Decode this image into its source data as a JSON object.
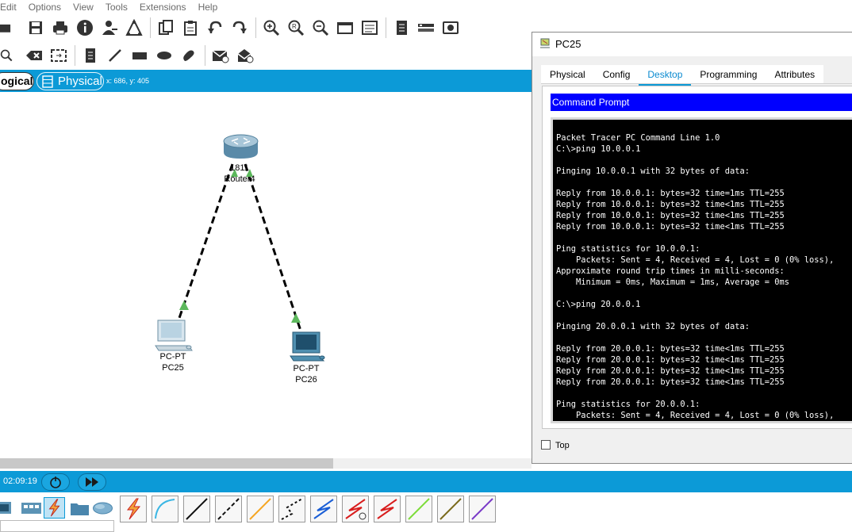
{
  "menu": [
    "Edit",
    "Options",
    "View",
    "Tools",
    "Extensions",
    "Help"
  ],
  "toolbar_icons": [
    "folder-icon",
    "save-icon",
    "print-icon",
    "info-icon",
    "user-icon",
    "network-icon",
    "copy-icon",
    "paste-icon",
    "undo-icon",
    "redo-icon",
    "zoom-in-icon",
    "zoom-reset-icon",
    "zoom-out-icon",
    "window-icon",
    "palette-icon",
    "notes-icon",
    "device-icon",
    "image-icon"
  ],
  "toolbar2_icons": [
    "select-icon",
    "delete-icon",
    "resize-icon",
    "note-icon",
    "line-icon",
    "rectangle-icon",
    "ellipse-icon",
    "freeform-icon",
    "add-pdu-icon",
    "add-complex-pdu-icon"
  ],
  "mode": {
    "logical": "ogical",
    "physical": "Physical",
    "coords": "x: 686, y: 405"
  },
  "devices": {
    "router": {
      "model": "1811",
      "name": "Router4"
    },
    "pc1": {
      "model": "PC-PT",
      "name": "PC25"
    },
    "pc2": {
      "model": "PC-PT",
      "name": "PC26"
    }
  },
  "time": "02:09:19",
  "window": {
    "title": "PC25",
    "tabs": [
      "Physical",
      "Config",
      "Desktop",
      "Programming",
      "Attributes"
    ],
    "active_tab": "Desktop",
    "app_title": "Command Prompt",
    "console_text": "Packet Tracer PC Command Line 1.0\nC:\\>ping 10.0.0.1\n\nPinging 10.0.0.1 with 32 bytes of data:\n\nReply from 10.0.0.1: bytes=32 time=1ms TTL=255\nReply from 10.0.0.1: bytes=32 time<1ms TTL=255\nReply from 10.0.0.1: bytes=32 time<1ms TTL=255\nReply from 10.0.0.1: bytes=32 time<1ms TTL=255\n\nPing statistics for 10.0.0.1:\n    Packets: Sent = 4, Received = 4, Lost = 0 (0% loss),\nApproximate round trip times in milli-seconds:\n    Minimum = 0ms, Maximum = 1ms, Average = 0ms\n\nC:\\>ping 20.0.0.1\n\nPinging 20.0.0.1 with 32 bytes of data:\n\nReply from 20.0.0.1: bytes=32 time<1ms TTL=255\nReply from 20.0.0.1: bytes=32 time<1ms TTL=255\nReply from 20.0.0.1: bytes=32 time<1ms TTL=255\nReply from 20.0.0.1: bytes=32 time<1ms TTL=255\n\nPing statistics for 20.0.0.1:\n    Packets: Sent = 4, Received = 4, Lost = 0 (0% loss),",
    "top_label": "Top"
  },
  "connection_types": [
    "automatic-connection-icon",
    "console-cable-icon",
    "copper-straight-icon",
    "copper-cross-icon",
    "fiber-icon",
    "phone-icon",
    "coaxial-icon",
    "serial-dce-icon",
    "serial-dte-icon",
    "octal-icon",
    "iot-icon",
    "usb-icon"
  ],
  "colors": {
    "accent": "#0c9ad7",
    "link_up": "#5cb85c",
    "console_bg": "#000000",
    "app_title_bg": "#0000ff"
  }
}
